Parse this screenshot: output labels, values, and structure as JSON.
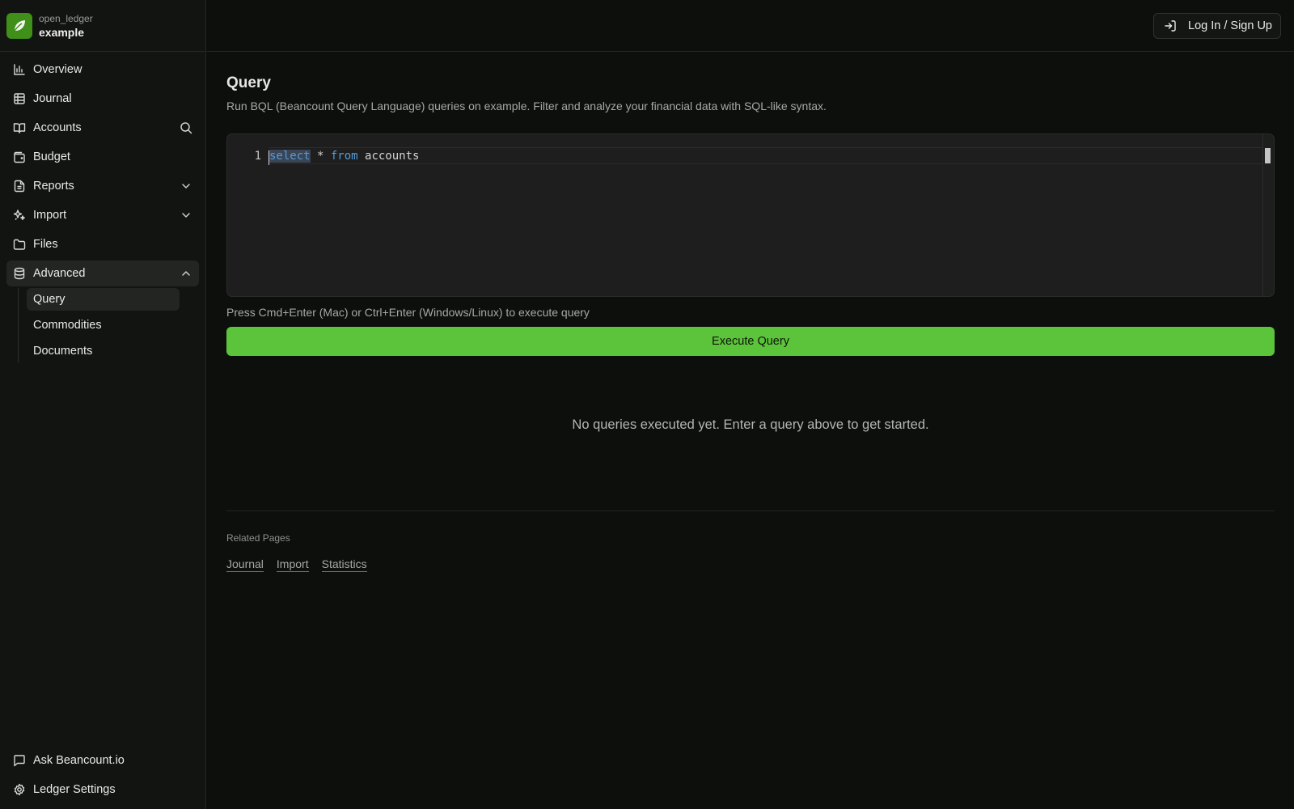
{
  "brand": {
    "org": "open_ledger",
    "name": "example",
    "logo_icon": "leaf-logo-icon",
    "accent": "#3f8f19"
  },
  "sidebar": {
    "items": [
      {
        "label": "Overview",
        "icon": "bar-chart-icon"
      },
      {
        "label": "Journal",
        "icon": "table-icon"
      },
      {
        "label": "Accounts",
        "icon": "book-open-icon",
        "right_icon": "search-icon"
      },
      {
        "label": "Budget",
        "icon": "wallet-icon"
      },
      {
        "label": "Reports",
        "icon": "file-text-icon",
        "right_icon": "chevron-down-icon"
      },
      {
        "label": "Import",
        "icon": "sparkles-icon",
        "right_icon": "chevron-down-icon"
      },
      {
        "label": "Files",
        "icon": "folder-icon"
      },
      {
        "label": "Advanced",
        "icon": "database-icon",
        "right_icon": "chevron-up-icon",
        "active": true
      }
    ],
    "advanced_sub": [
      {
        "label": "Query",
        "active": true
      },
      {
        "label": "Commodities"
      },
      {
        "label": "Documents"
      }
    ],
    "bottom": [
      {
        "label": "Ask Beancount.io",
        "icon": "message-square-icon"
      },
      {
        "label": "Ledger Settings",
        "icon": "gear-icon"
      }
    ]
  },
  "topbar": {
    "login_label": "Log In / Sign Up",
    "login_icon": "log-in-icon"
  },
  "main": {
    "title": "Query",
    "description": "Run BQL (Beancount Query Language) queries on example. Filter and analyze your financial data with SQL-like syntax.",
    "editor": {
      "line_number": "1",
      "tokens": {
        "kw1": "select",
        "op": " * ",
        "kw2": "from",
        "rest": " accounts"
      }
    },
    "hint": "Press Cmd+Enter (Mac) or Ctrl+Enter (Windows/Linux) to execute query",
    "execute_label": "Execute Query",
    "execute_color": "#5cc43a",
    "empty_state": "No queries executed yet. Enter a query above to get started.",
    "related": {
      "title": "Related Pages",
      "links": [
        "Journal",
        "Import",
        "Statistics"
      ]
    }
  }
}
